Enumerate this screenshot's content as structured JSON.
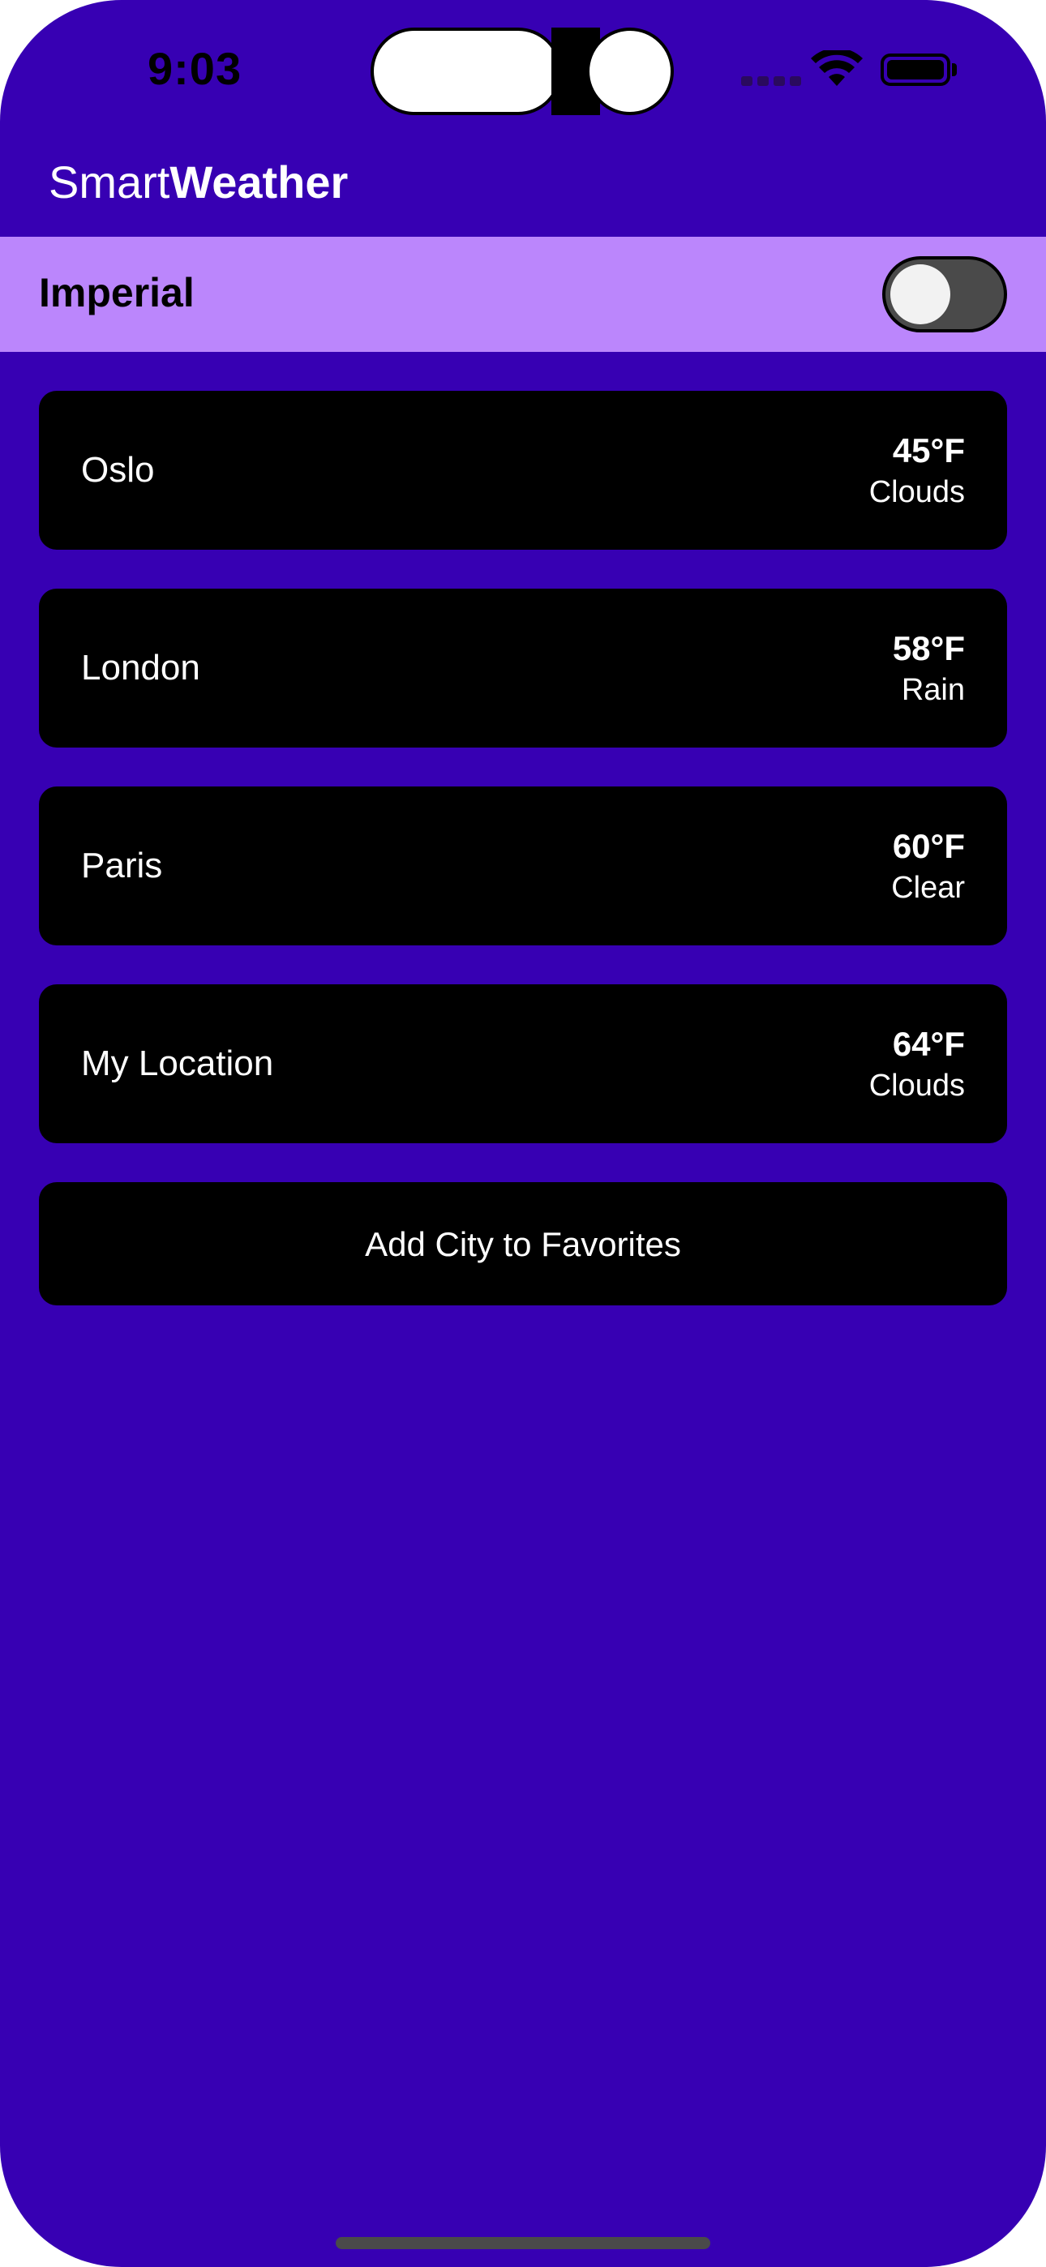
{
  "status_bar": {
    "time": "9:03",
    "icons": [
      "cellular-signal-icon",
      "wifi-icon",
      "battery-icon"
    ]
  },
  "header": {
    "title_light": "Smart",
    "title_bold": "Weather"
  },
  "units": {
    "label": "Imperial",
    "toggle_on": false
  },
  "cities": [
    {
      "name": "Oslo",
      "temp": "45°F",
      "condition": "Clouds"
    },
    {
      "name": "London",
      "temp": "58°F",
      "condition": "Rain"
    },
    {
      "name": "Paris",
      "temp": "60°F",
      "condition": "Clear"
    },
    {
      "name": "My Location",
      "temp": "64°F",
      "condition": "Clouds"
    }
  ],
  "add_button_label": "Add City to Favorites",
  "colors": {
    "background": "#3700b3",
    "units_bar": "#bb86fc",
    "card": "#000000",
    "text": "#ffffff"
  }
}
